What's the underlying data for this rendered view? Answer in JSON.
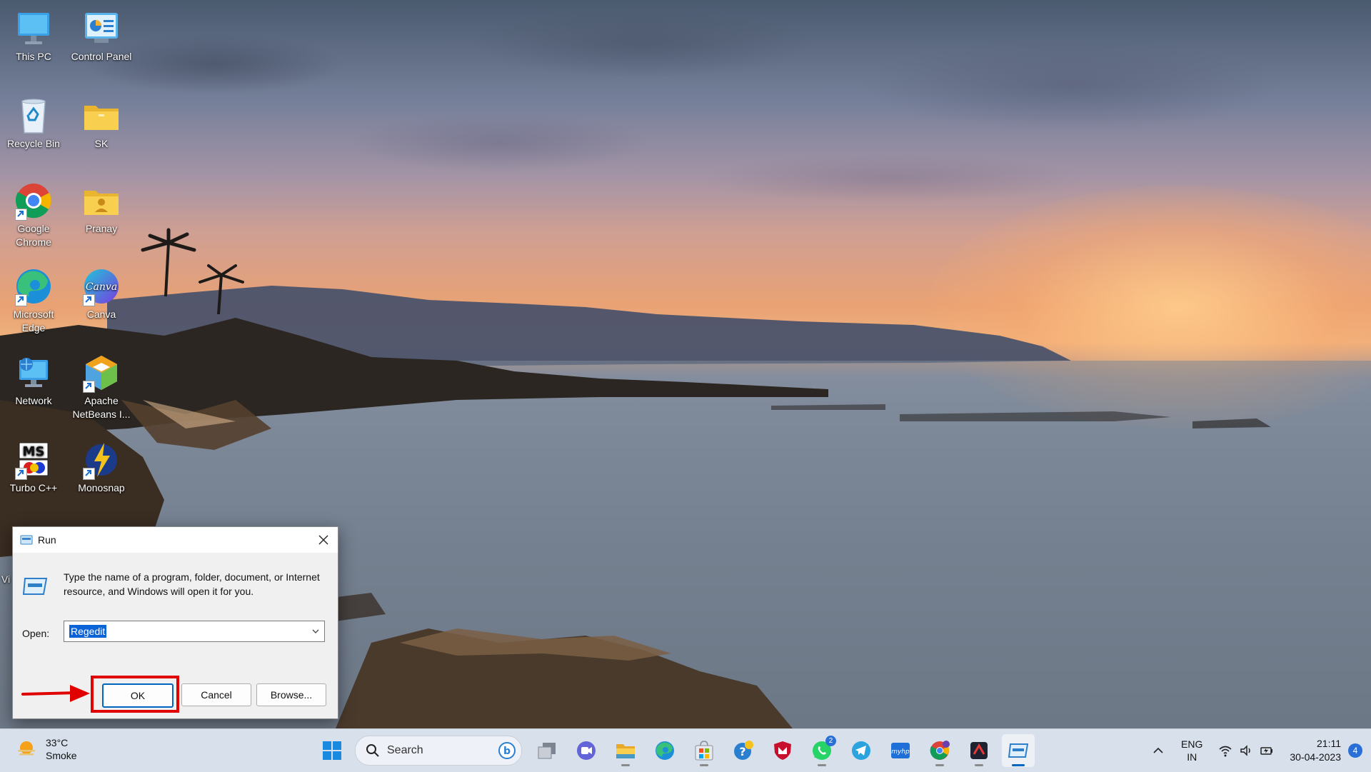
{
  "desktop": {
    "icons": [
      {
        "label": "This PC",
        "icon": "monitor-icon"
      },
      {
        "label": "Control Panel",
        "icon": "control-panel-icon"
      },
      {
        "label": "Recycle Bin",
        "icon": "recycle-bin-icon"
      },
      {
        "label": "SK",
        "icon": "folder-icon"
      },
      {
        "label": "Google Chrome",
        "icon": "chrome-icon"
      },
      {
        "label": "Pranay",
        "icon": "user-folder-icon"
      },
      {
        "label": "Microsoft Edge",
        "icon": "edge-icon"
      },
      {
        "label": "Canva",
        "icon": "canva-icon"
      },
      {
        "label": "Network",
        "icon": "network-icon"
      },
      {
        "label": "Apache NetBeans I...",
        "icon": "netbeans-icon"
      },
      {
        "label": "Turbo C++",
        "icon": "turbo-cpp-icon"
      },
      {
        "label": "Monosnap",
        "icon": "monosnap-icon"
      }
    ],
    "partial_label": "Vi"
  },
  "run_dialog": {
    "title": "Run",
    "description": "Type the name of a program, folder, document, or Internet resource, and Windows will open it for you.",
    "open_label": "Open:",
    "open_value": "Regedit",
    "ok_label": "OK",
    "cancel_label": "Cancel",
    "browse_label": "Browse..."
  },
  "taskbar": {
    "weather": {
      "temp": "33°C",
      "condition": "Smoke"
    },
    "search_placeholder": "Search",
    "apps": [
      {
        "name": "start-icon"
      },
      {
        "name": "task-view-icon"
      },
      {
        "name": "teams-chat-icon"
      },
      {
        "name": "file-explorer-icon"
      },
      {
        "name": "edge-icon"
      },
      {
        "name": "microsoft-store-icon"
      },
      {
        "name": "get-help-icon"
      },
      {
        "name": "mcafee-icon"
      },
      {
        "name": "whatsapp-icon",
        "badge": "2"
      },
      {
        "name": "telegram-icon"
      },
      {
        "name": "myhp-icon"
      },
      {
        "name": "chrome-icon"
      },
      {
        "name": "monosnap-icon"
      },
      {
        "name": "run-icon"
      }
    ],
    "language": {
      "line1": "ENG",
      "line2": "IN"
    },
    "time": "21:11",
    "date": "30-04-2023",
    "notification_count": "4"
  },
  "colors": {
    "highlight_red": "#e00000",
    "accent_blue": "#0067c0",
    "selection_blue": "#0a64d8"
  }
}
